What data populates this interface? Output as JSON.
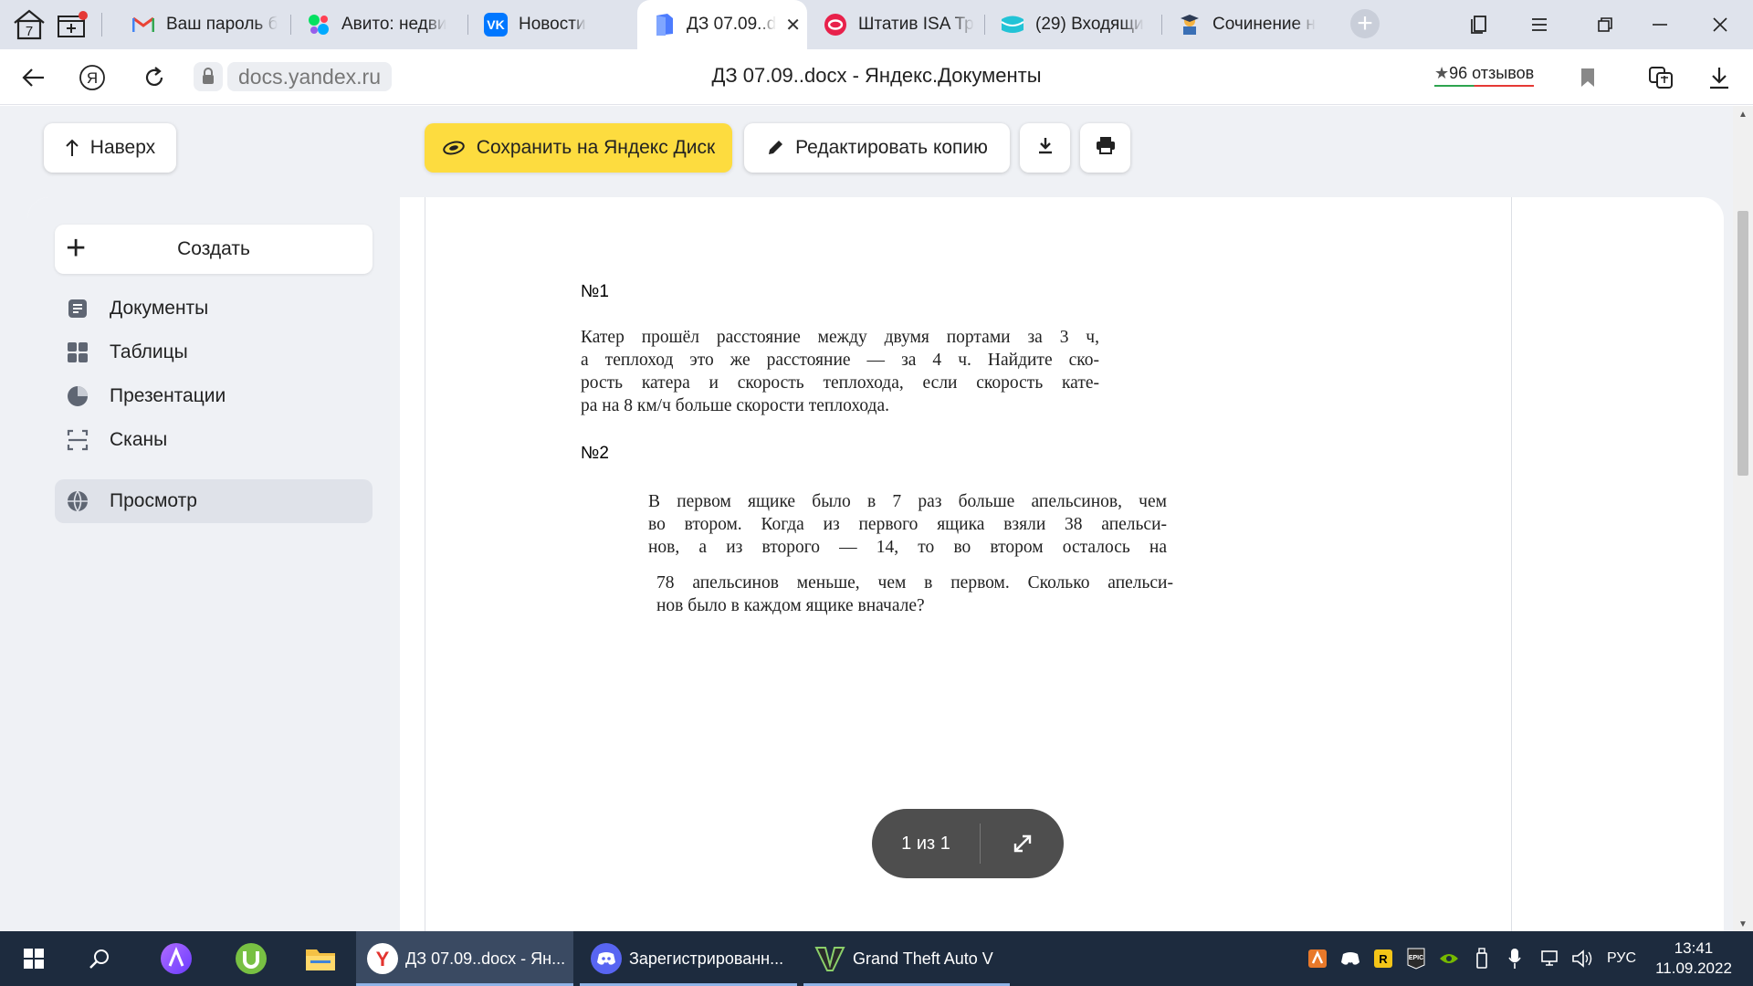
{
  "browser": {
    "tab_counter": "7",
    "tabs": [
      {
        "title": "Ваш пароль б",
        "favicon": "gmail-icon"
      },
      {
        "title": "Авито: недви",
        "favicon": "avito-icon"
      },
      {
        "title": "Новости",
        "favicon": "vk-icon"
      },
      {
        "title": "ДЗ 07.09..d",
        "favicon": "yandex-docs-icon",
        "active": true
      },
      {
        "title": "Штатив ISA Тр",
        "favicon": "ozon-icon"
      },
      {
        "title": "(29) Входящи",
        "favicon": "mail-icon"
      },
      {
        "title": "Сочинение н",
        "favicon": "school-icon"
      }
    ],
    "url": "docs.yandex.ru",
    "page_title": "ДЗ 07.09..docx - Яндекс.Документы",
    "reviews": "96 отзывов",
    "reviews_star": "★"
  },
  "toolbar": {
    "up_label": "Наверх",
    "save_label": "Сохранить на Яндекс Диск",
    "edit_label": "Редактировать копию"
  },
  "sidebar": {
    "create_label": "Создать",
    "items": [
      {
        "label": "Документы",
        "icon": "document-icon"
      },
      {
        "label": "Таблицы",
        "icon": "table-icon"
      },
      {
        "label": "Презентации",
        "icon": "presentation-icon"
      },
      {
        "label": "Сканы",
        "icon": "scan-icon"
      },
      {
        "label": "Просмотр",
        "icon": "globe-icon",
        "active": true
      }
    ]
  },
  "document": {
    "task1_heading": "№1",
    "task1_lines": [
      "Катер прошёл расстояние между двумя портами за 3 ч,",
      "а теплоход это же расстояние — за 4 ч. Найдите ско-",
      "рость катера и скорость теплохода, если скорость кате-",
      "ра на 8 км/ч больше скорости теплохода."
    ],
    "task2_heading": "№2",
    "task2_lines_a": [
      "В первом ящике было в 7 раз больше апельсинов, чем",
      "во втором. Когда из первого ящика взяли 38 апельси-",
      "нов, а из второго — 14, то во втором осталось на"
    ],
    "task2_lines_b": [
      "78 апельсинов меньше, чем в первом. Сколько апельси-",
      "нов было в каждом ящике вначале?"
    ]
  },
  "pager": {
    "label": "1 из 1"
  },
  "taskbar": {
    "apps": [
      {
        "label": "ДЗ 07.09..docx - Ян...",
        "icon": "yandex-browser-icon",
        "active": true
      },
      {
        "label": "Зарегистрированн...",
        "icon": "discord-icon"
      },
      {
        "label": "Grand Theft Auto V",
        "icon": "gta-icon"
      }
    ],
    "lang": "РУС",
    "time": "13:41",
    "date": "11.09.2022"
  }
}
